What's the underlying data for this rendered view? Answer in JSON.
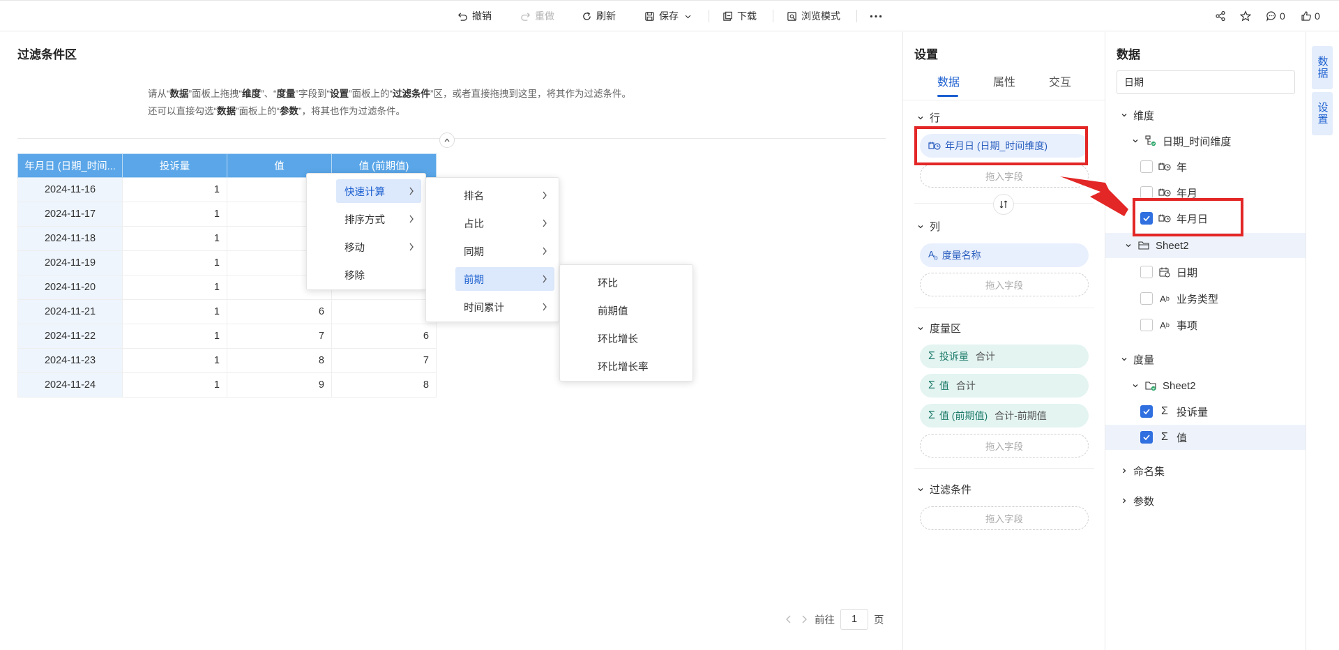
{
  "toolbar": {
    "undo": "撤销",
    "redo": "重做",
    "refresh": "刷新",
    "save": "保存",
    "download": "下载",
    "browse": "浏览模式",
    "comments": "0",
    "likes": "0"
  },
  "canvas": {
    "filter_title": "过滤条件区",
    "hint_line1": [
      "请从“",
      "数据",
      "”面板上拖拽“",
      "维度",
      "”、“",
      "度量",
      "”字段到“",
      "设置",
      "”面板上的“",
      "过滤条件",
      "”区，或者直接拖拽到这里，将其作为过滤条件。"
    ],
    "hint_line2": [
      "还可以直接勾选“",
      "数据",
      "”面板上的“",
      "参数",
      "”，将其也作为过滤条件。"
    ]
  },
  "table": {
    "headers": [
      "年月日 (日期_时间...",
      "投诉量",
      "值",
      "值 (前期值)"
    ],
    "rows": [
      [
        "2024-11-16",
        "1",
        "",
        ""
      ],
      [
        "2024-11-17",
        "1",
        "",
        ""
      ],
      [
        "2024-11-18",
        "1",
        "",
        ""
      ],
      [
        "2024-11-19",
        "1",
        "",
        ""
      ],
      [
        "2024-11-20",
        "1",
        "",
        ""
      ],
      [
        "2024-11-21",
        "1",
        "6",
        ""
      ],
      [
        "2024-11-22",
        "1",
        "7",
        "6"
      ],
      [
        "2024-11-23",
        "1",
        "8",
        "7"
      ],
      [
        "2024-11-24",
        "1",
        "9",
        "8"
      ]
    ]
  },
  "menu1": {
    "items": [
      "快速计算",
      "排序方式",
      "移动",
      "移除"
    ]
  },
  "menu2": {
    "items": [
      "排名",
      "占比",
      "同期",
      "前期",
      "时间累计"
    ]
  },
  "menu3": {
    "items": [
      "环比",
      "前期值",
      "环比增长",
      "环比增长率"
    ]
  },
  "pager": {
    "goto": "前往",
    "page": "1",
    "unit": "页"
  },
  "settings": {
    "title": "设置",
    "tabs": [
      "数据",
      "属性",
      "交互"
    ],
    "rows_label": "行",
    "rows_field": "年月日 (日期_时间维度)",
    "drop_label": "拖入字段",
    "cols_label": "列",
    "cols_field": "度量名称",
    "measures_label": "度量区",
    "measures": [
      {
        "name": "投诉量",
        "agg": "合计"
      },
      {
        "name": "值",
        "agg": "合计"
      },
      {
        "name": "值 (前期值)",
        "agg": "合计-前期值"
      }
    ],
    "filter_label": "过滤条件"
  },
  "data_panel": {
    "title": "数据",
    "search_value": "日期",
    "dim_label": "维度",
    "dim_group": "日期_时间维度",
    "dim_items": [
      "年",
      "年月",
      "年月日"
    ],
    "sheet_label": "Sheet2",
    "sheet_items": [
      "日期",
      "业务类型",
      "事项"
    ],
    "measure_label": "度量",
    "measure_sheet": "Sheet2",
    "measure_items": [
      "投诉量",
      "值"
    ],
    "named_set": "命名集",
    "params": "参数"
  },
  "rail": {
    "tab1": "数据",
    "tab2": "设置"
  },
  "colors": {
    "accent": "#1b5fd0",
    "header": "#5aa6e8",
    "annotation": "#e32626"
  }
}
